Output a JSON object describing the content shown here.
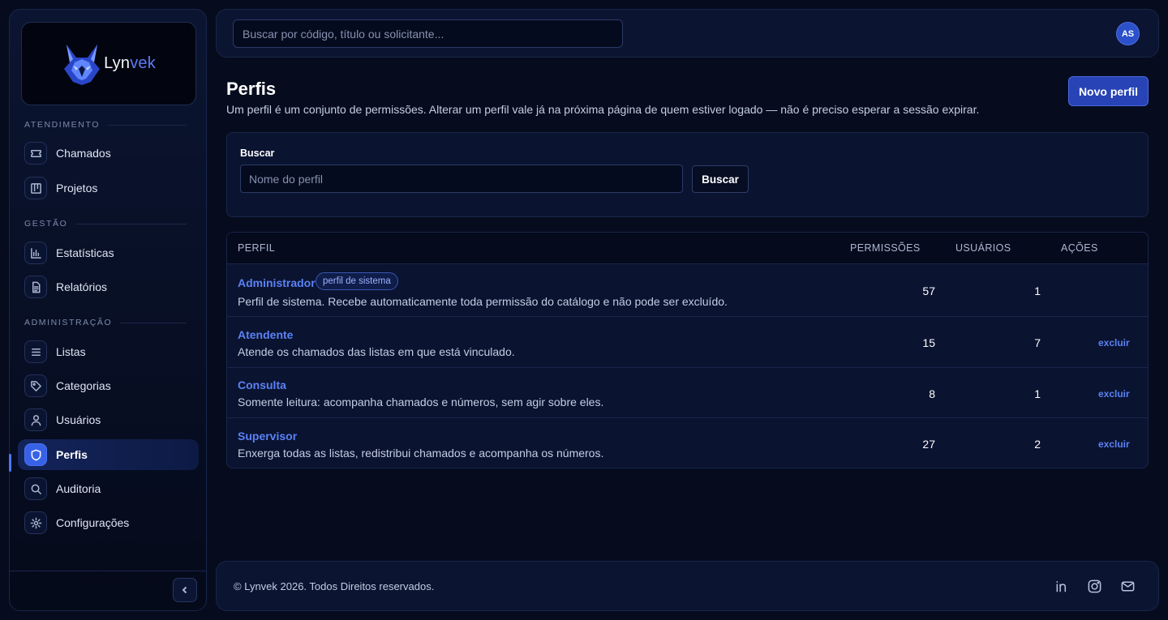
{
  "brand": {
    "name_part1": "Lyn",
    "name_part2": "vek"
  },
  "sidebar": {
    "sections": [
      {
        "label": "ATENDIMENTO"
      },
      {
        "label": "GESTÃO"
      },
      {
        "label": "ADMINISTRAÇÃO"
      }
    ],
    "items": [
      {
        "label": "Chamados",
        "icon": "ticket-icon"
      },
      {
        "label": "Projetos",
        "icon": "kanban-icon"
      },
      {
        "label": "Estatísticas",
        "icon": "bar-chart-icon"
      },
      {
        "label": "Relatórios",
        "icon": "document-icon"
      },
      {
        "label": "Listas",
        "icon": "list-icon"
      },
      {
        "label": "Categorias",
        "icon": "tag-icon"
      },
      {
        "label": "Usuários",
        "icon": "user-icon"
      },
      {
        "label": "Perfis",
        "icon": "shield-icon",
        "active": true
      },
      {
        "label": "Auditoria",
        "icon": "search-icon"
      },
      {
        "label": "Configurações",
        "icon": "gear-icon"
      }
    ]
  },
  "topbar": {
    "search_placeholder": "Buscar por código, título ou solicitante...",
    "search_value": "",
    "avatar_initials": "AS"
  },
  "page": {
    "title": "Perfis",
    "subtitle": "Um perfil é um conjunto de permissões. Alterar um perfil vale já na próxima página de quem estiver logado — não é preciso esperar a sessão expirar.",
    "new_button": "Novo perfil"
  },
  "filter": {
    "label": "Buscar",
    "placeholder": "Nome do perfil",
    "value": "",
    "button": "Buscar"
  },
  "table": {
    "columns": [
      "PERFIL",
      "PERMISSÕES",
      "USUÁRIOS",
      "AÇÕES"
    ],
    "rows": [
      {
        "name": "Administrador",
        "badge": "perfil de sistema",
        "description": "Perfil de sistema. Recebe automaticamente toda permissão do catálogo e não pode ser excluído.",
        "permissions": "57",
        "users": "1",
        "action": ""
      },
      {
        "name": "Atendente",
        "badge": "",
        "description": "Atende os chamados das listas em que está vinculado.",
        "permissions": "15",
        "users": "7",
        "action": "excluir"
      },
      {
        "name": "Consulta",
        "badge": "",
        "description": "Somente leitura: acompanha chamados e números, sem agir sobre eles.",
        "permissions": "8",
        "users": "1",
        "action": "excluir"
      },
      {
        "name": "Supervisor",
        "badge": "",
        "description": "Enxerga todas as listas, redistribui chamados e acompanha os números.",
        "permissions": "27",
        "users": "2",
        "action": "excluir"
      }
    ]
  },
  "footer": {
    "copyright": "© Lynvek 2026. Todos Direitos reservados.",
    "social": [
      "linkedin-icon",
      "instagram-icon",
      "mail-icon"
    ]
  },
  "colors": {
    "background": "#060c1e",
    "panel": "#0a1330",
    "accent": "#3762e8",
    "link": "#5b82f5"
  }
}
